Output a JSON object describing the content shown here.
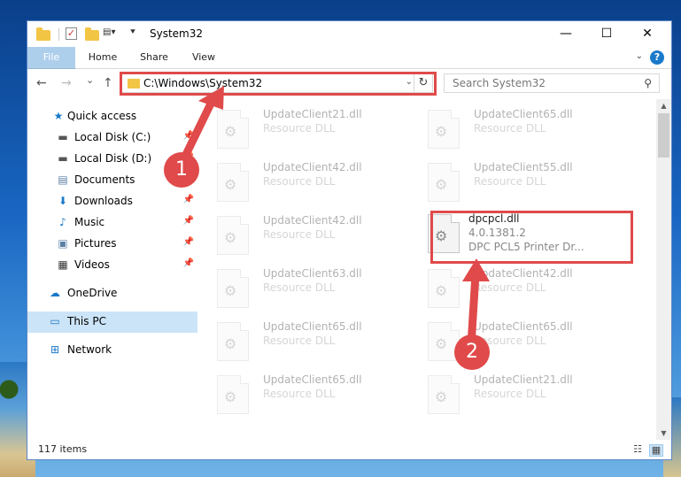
{
  "window": {
    "title": "System32",
    "controls": {
      "minimize": "—",
      "maximize": "☐",
      "close": "✕"
    }
  },
  "ribbon": {
    "tabs": [
      "File",
      "Home",
      "Share",
      "View"
    ],
    "help": "?"
  },
  "nav": {
    "back": "←",
    "forward": "→",
    "recent": "⌄",
    "up": "↑",
    "address": "C:\\Windows\\System32",
    "refresh": "↻",
    "search_placeholder": "Search System32",
    "search_icon": "⚲"
  },
  "sidebar": {
    "items": [
      {
        "label": "Quick access",
        "icon": "star-icon",
        "glyph": "★",
        "pinned": false
      },
      {
        "label": "Local Disk (C:)",
        "icon": "drive-icon",
        "glyph": "▬",
        "pinned": true
      },
      {
        "label": "Local Disk (D:)",
        "icon": "drive-icon",
        "glyph": "▬",
        "pinned": true
      },
      {
        "label": "Documents",
        "icon": "document-icon",
        "glyph": "▤",
        "pinned": true
      },
      {
        "label": "Downloads",
        "icon": "download-icon",
        "glyph": "⬇",
        "pinned": true
      },
      {
        "label": "Music",
        "icon": "music-icon",
        "glyph": "♪",
        "pinned": true
      },
      {
        "label": "Pictures",
        "icon": "pictures-icon",
        "glyph": "▣",
        "pinned": true
      },
      {
        "label": "Videos",
        "icon": "videos-icon",
        "glyph": "▦",
        "pinned": true
      },
      {
        "label": "OneDrive",
        "icon": "cloud-icon",
        "glyph": "☁",
        "pinned": false
      },
      {
        "label": "This PC",
        "icon": "computer-icon",
        "glyph": "▭",
        "pinned": false,
        "selected": true
      },
      {
        "label": "Network",
        "icon": "network-icon",
        "glyph": "⊞",
        "pinned": false
      }
    ]
  },
  "files": [
    {
      "name": "UpdateClient21.dll",
      "desc": "Resource DLL"
    },
    {
      "name": "UpdateClient65.dll",
      "desc": "Resource DLL"
    },
    {
      "name": "UpdateClient42.dll",
      "desc": "Resource DLL"
    },
    {
      "name": "UpdateClient55.dll",
      "desc": "Resource DLL"
    },
    {
      "name": "UpdateClient42.dll",
      "desc": "Resource DLL"
    },
    {
      "name": "dpcpcl.dll",
      "desc": "4.0.1381.2",
      "desc2": "DPC PCL5 Printer Dr...",
      "highlighted": true
    },
    {
      "name": "UpdateClient63.dll",
      "desc": "Resource DLL"
    },
    {
      "name": "UpdateClient42.dll",
      "desc": "Resource DLL"
    },
    {
      "name": "UpdateClient65.dll",
      "desc": "Resource DLL"
    },
    {
      "name": "UpdateClient65.dll",
      "desc": "Resource DLL"
    },
    {
      "name": "UpdateClient65.dll",
      "desc": "Resource DLL"
    },
    {
      "name": "UpdateClient21.dll",
      "desc": "Resource DLL"
    }
  ],
  "status": {
    "item_count": "117 items"
  },
  "annotations": {
    "step1": "1",
    "step2": "2",
    "color": "#e04a4a"
  }
}
